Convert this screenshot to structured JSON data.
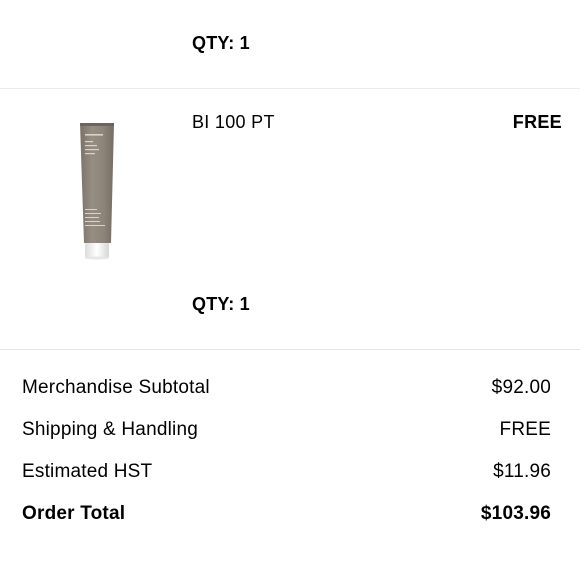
{
  "items": [
    {
      "qty_label": "QTY: 1"
    },
    {
      "name": "BI 100 PT",
      "price": "FREE",
      "qty_label": "QTY: 1",
      "image": {
        "type": "product-tube",
        "brand_text": "Living proof"
      }
    }
  ],
  "summary": {
    "subtotal_label": "Merchandise Subtotal",
    "subtotal_value": "$92.00",
    "shipping_label": "Shipping & Handling",
    "shipping_value": "FREE",
    "hst_label": "Estimated HST",
    "hst_value": "$11.96",
    "total_label": "Order Total",
    "total_value": "$103.96"
  },
  "colors": {
    "text": "#000000",
    "divider": "#e5e5e5",
    "tube": "#8c8379",
    "tube_cap": "#f4f4f4"
  }
}
